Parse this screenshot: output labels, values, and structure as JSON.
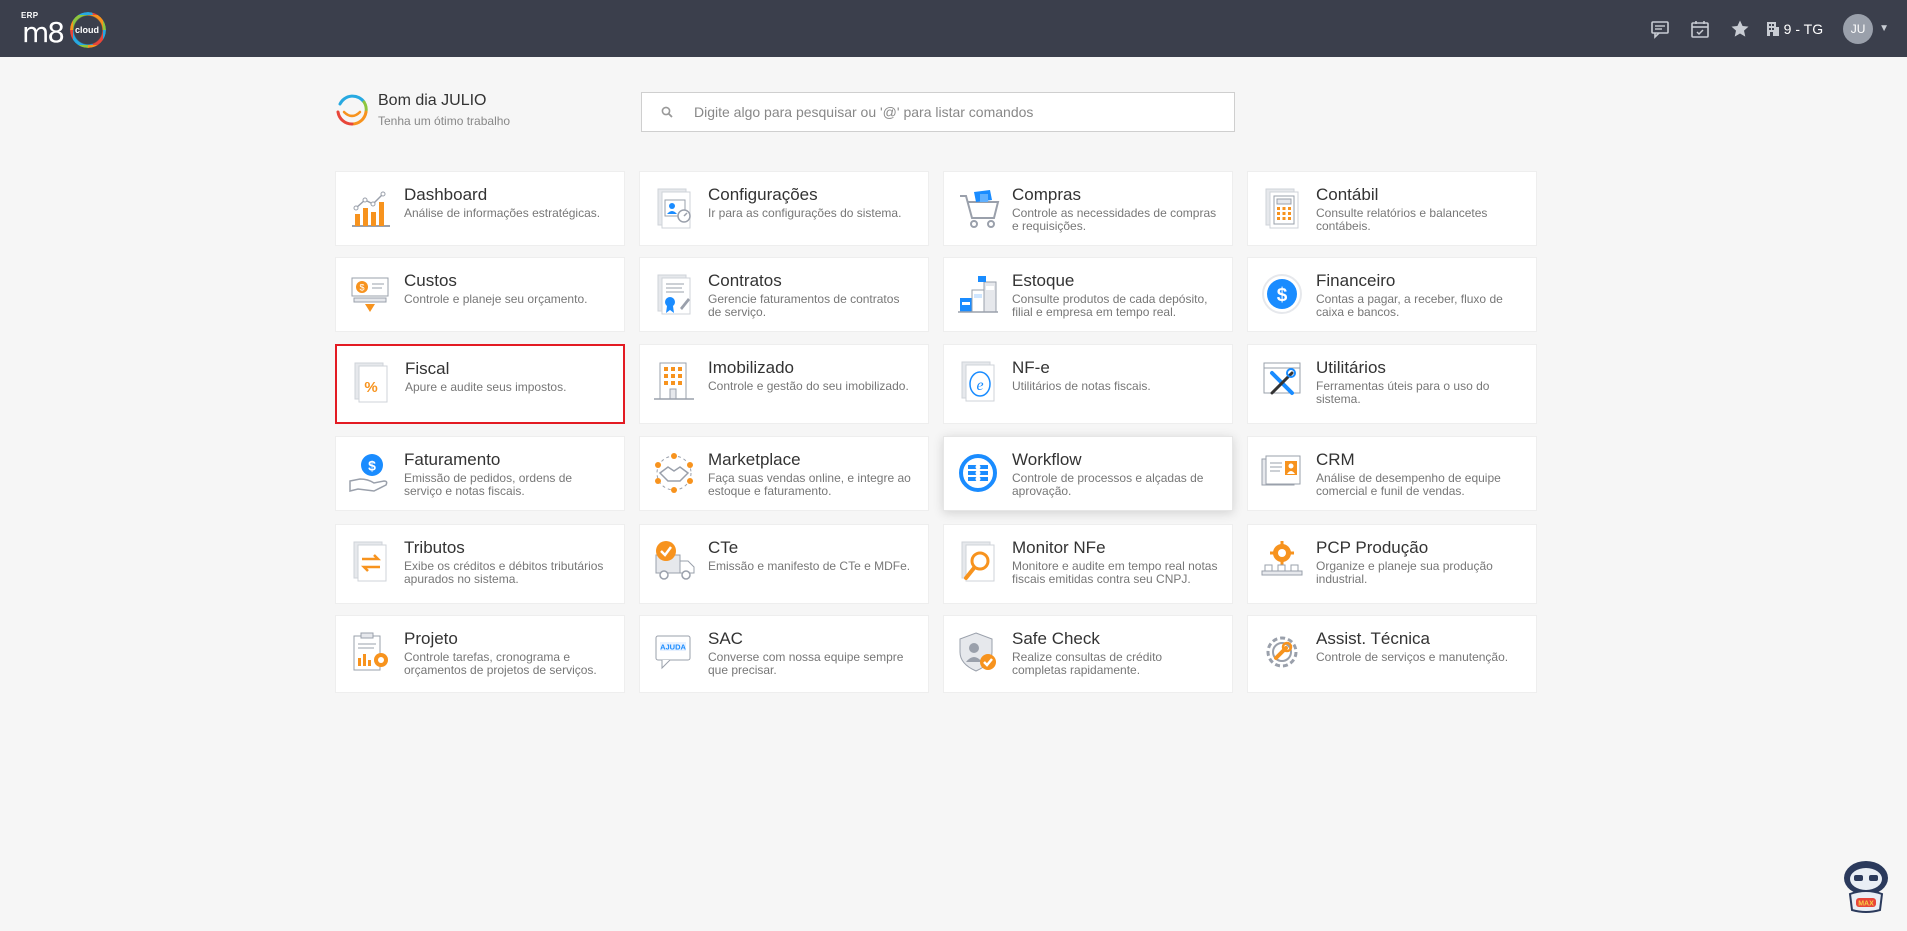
{
  "topbar": {
    "logo": {
      "erp": "ERP",
      "brand": "m8",
      "cloud": "cloud"
    },
    "icons": [
      "chat-icon",
      "calendar-icon",
      "star-icon"
    ],
    "company_label": "9 - TG",
    "user_initials": "JU"
  },
  "greeting": {
    "title": "Bom dia JULIO",
    "subtitle": "Tenha um ótimo trabalho"
  },
  "search": {
    "placeholder": "Digite algo para pesquisar ou '@' para listar comandos"
  },
  "modules": [
    {
      "title": "Dashboard",
      "desc": "Análise de informações estratégicas.",
      "icon": "bar-chart-icon"
    },
    {
      "title": "Configurações",
      "desc": "Ir para as configurações do sistema.",
      "icon": "settings-profile-icon"
    },
    {
      "title": "Compras",
      "desc": "Controle as necessidades de compras e requisições.",
      "icon": "shopping-cart-icon"
    },
    {
      "title": "Contábil",
      "desc": "Consulte relatórios e balancetes contábeis.",
      "icon": "calculator-icon"
    },
    {
      "title": "Custos",
      "desc": "Controle e planeje seu orçamento.",
      "icon": "cost-bill-icon"
    },
    {
      "title": "Contratos",
      "desc": "Gerencie faturamentos de contratos de serviço.",
      "icon": "contract-icon"
    },
    {
      "title": "Estoque",
      "desc": "Consulte produtos de cada depósito, filial e empresa em tempo real.",
      "icon": "warehouse-icon"
    },
    {
      "title": "Financeiro",
      "desc": "Contas a pagar, a receber, fluxo de caixa e bancos.",
      "icon": "dollar-coin-icon"
    },
    {
      "title": "Fiscal",
      "desc": "Apure e audite seus impostos.",
      "icon": "percent-document-icon"
    },
    {
      "title": "Imobilizado",
      "desc": "Controle e gestão do seu imobilizado.",
      "icon": "building-icon"
    },
    {
      "title": "NF-e",
      "desc": "Utilitários de notas fiscais.",
      "icon": "nfe-document-icon"
    },
    {
      "title": "Utilitários",
      "desc": "Ferramentas úteis para o uso do sistema.",
      "icon": "tools-icon"
    },
    {
      "title": "Faturamento",
      "desc": "Emissão de pedidos, ordens de serviço e notas fiscais.",
      "icon": "hand-dollar-icon"
    },
    {
      "title": "Marketplace",
      "desc": "Faça suas vendas online, e integre ao estoque e faturamento.",
      "icon": "handshake-icon"
    },
    {
      "title": "Workflow",
      "desc": "Controle de processos e alçadas de aprovação.",
      "icon": "workflow-icon"
    },
    {
      "title": "CRM",
      "desc": "Análise de desempenho de equipe comercial e funil de vendas.",
      "icon": "crm-contacts-icon"
    },
    {
      "title": "Tributos",
      "desc": "Exibe os créditos e débitos tributários apurados no sistema.",
      "icon": "tax-exchange-icon"
    },
    {
      "title": "CTe",
      "desc": "Emissão e manifesto de CTe e MDFe.",
      "icon": "truck-check-icon"
    },
    {
      "title": "Monitor NFe",
      "desc": "Monitore e audite em tempo real notas fiscais emitidas contra seu CNPJ.",
      "icon": "magnifier-document-icon"
    },
    {
      "title": "PCP Produção",
      "desc": "Organize e planeje sua produção industrial.",
      "icon": "production-gear-icon"
    },
    {
      "title": "Projeto",
      "desc": "Controle tarefas, cronograma e orçamentos de projetos de serviços.",
      "icon": "clipboard-gear-icon"
    },
    {
      "title": "SAC",
      "desc": "Converse com nossa equipe sempre que precisar.",
      "icon": "help-chat-icon"
    },
    {
      "title": "Safe Check",
      "desc": "Realize consultas de crédito completas rapidamente.",
      "icon": "shield-check-icon"
    },
    {
      "title": "Assist. Técnica",
      "desc": "Controle de serviços e manutenção.",
      "icon": "wrench-gear-icon"
    }
  ],
  "bot": {
    "label": "MAX"
  },
  "colors": {
    "topbar": "#3b3f4c",
    "orange": "#f7931e",
    "blue": "#1a8cff",
    "highlight": "#e31b23"
  }
}
